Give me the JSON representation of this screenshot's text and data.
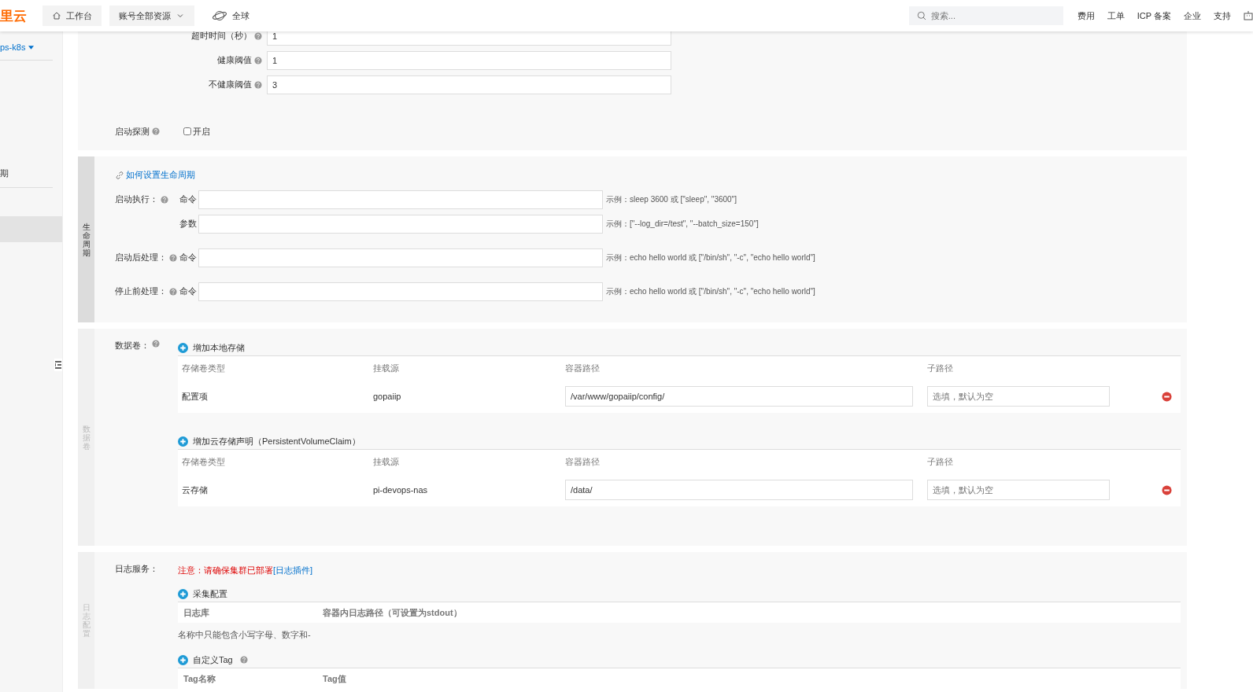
{
  "header": {
    "logo": "里云",
    "nav": [
      {
        "kind": "home",
        "label": "工作台"
      },
      {
        "kind": "dropdown",
        "label": "账号全部资源"
      },
      {
        "kind": "globe",
        "label": "全球"
      }
    ],
    "search": {
      "placeholder": "搜索..."
    },
    "links": [
      "费用",
      "工单",
      "ICP 备案",
      "企业",
      "支持"
    ]
  },
  "sidebar": {
    "cluster": "ps-k8s",
    "items": [
      {
        "label": "期"
      }
    ]
  },
  "health_check": {
    "rows": [
      {
        "label": "超时时间（秒）",
        "value": "1"
      },
      {
        "label": "健康阈值",
        "value": "1"
      },
      {
        "label": "不健康阈值",
        "value": "3"
      }
    ],
    "startup_probe": {
      "label": "启动探测",
      "option": "开启",
      "checked": false
    }
  },
  "lifecycle": {
    "tab": "生命周期",
    "selected": true,
    "help_link": "如何设置生命周期",
    "groups": [
      {
        "label": "启动执行：",
        "fields": [
          {
            "label": "命令",
            "hint": "示例：sleep 3600 或 [\"sleep\", \"3600\"]"
          },
          {
            "label": "参数",
            "hint": "示例：[\"--log_dir=/test\", \"--batch_size=150\"]"
          }
        ]
      },
      {
        "label": "启动后处理：",
        "fields": [
          {
            "label": "命令",
            "hint": "示例：echo hello world 或 [\"/bin/sh\", \"-c\", \"echo hello world\"]"
          }
        ]
      },
      {
        "label": "停止前处理：",
        "fields": [
          {
            "label": "命令",
            "hint": "示例：echo hello world 或 [\"/bin/sh\", \"-c\", \"echo hello world\"]"
          }
        ]
      }
    ]
  },
  "volumes": {
    "tab": "数据卷",
    "selected": false,
    "label": "数据卷：",
    "groups": [
      {
        "add": "增加本地存储",
        "columns": [
          "存储卷类型",
          "挂载源",
          "容器路径",
          "子路径"
        ],
        "rows": [
          {
            "type": "配置项",
            "source": "gopaiip",
            "path": "/var/www/gopaiip/config/",
            "subpath_placeholder": "选填，默认为空"
          }
        ]
      },
      {
        "add": "增加云存储声明（PersistentVolumeClaim）",
        "columns": [
          "存储卷类型",
          "挂载源",
          "容器路径",
          "子路径"
        ],
        "rows": [
          {
            "type": "云存储",
            "source": "pi-devops-nas",
            "path": "/data/",
            "subpath_placeholder": "选填，默认为空"
          }
        ]
      }
    ]
  },
  "logs": {
    "tab": "日志配置",
    "selected": false,
    "label": "日志服务：",
    "notice": "注意：请确保集群已部署",
    "notice_link": "[日志插件]",
    "collect": {
      "add": "采集配置",
      "columns": [
        "日志库",
        "容器内日志路径（可设置为stdout）"
      ],
      "hint": "名称中只能包含小写字母、数字和-"
    },
    "tags": {
      "add": "自定义Tag",
      "columns": [
        "Tag名称",
        "Tag值"
      ]
    }
  }
}
